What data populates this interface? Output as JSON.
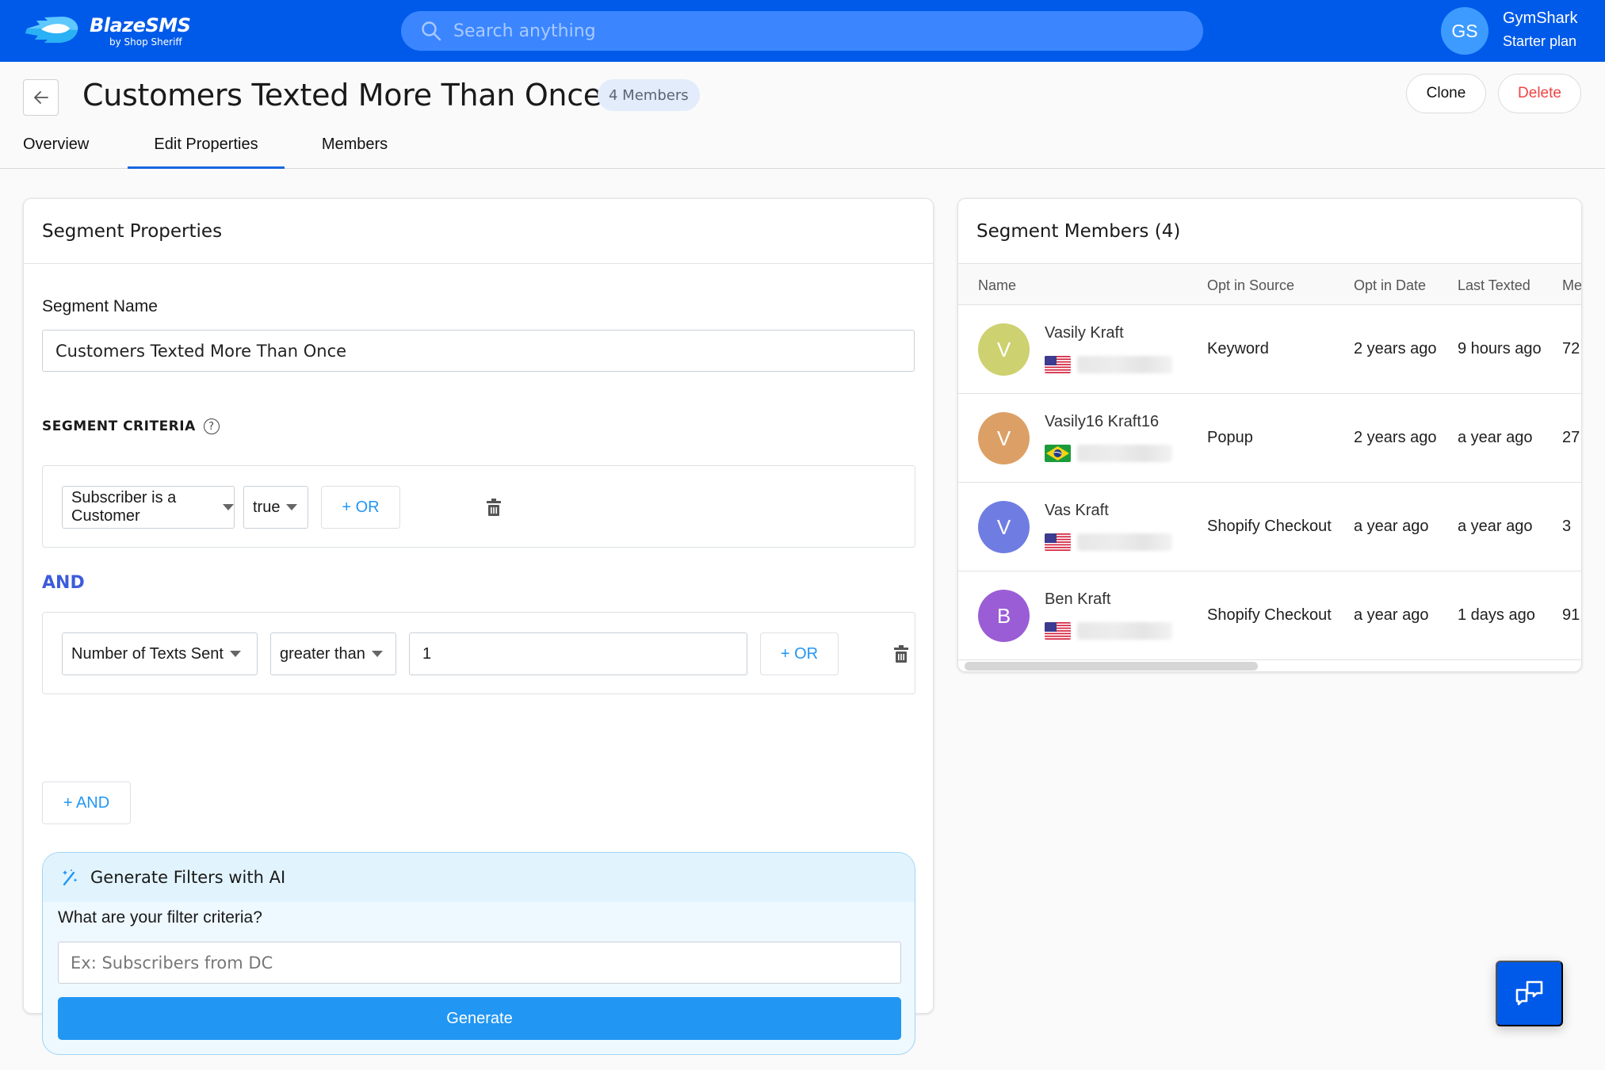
{
  "header": {
    "brand_name": "BlazeSMS",
    "brand_sub": "by Shop Sheriff",
    "search_placeholder": "Search anything",
    "user_initials": "GS",
    "user_name": "GymShark",
    "user_plan": "Starter plan"
  },
  "page": {
    "title": "Customers Texted More Than Once",
    "members_badge": "4 Members",
    "clone_label": "Clone",
    "delete_label": "Delete",
    "tabs": [
      {
        "label": "Overview",
        "active": false
      },
      {
        "label": "Edit Properties",
        "active": true
      },
      {
        "label": "Members",
        "active": false
      }
    ]
  },
  "properties": {
    "title": "Segment Properties",
    "name_label": "Segment Name",
    "name_value": "Customers Texted More Than Once",
    "criteria_title": "SEGMENT CRITERIA",
    "help_icon": "?",
    "rules": [
      {
        "field": "Subscriber is a Customer",
        "operator": "true",
        "value": null,
        "or_label": "+ OR"
      },
      {
        "field": "Number of Texts Sent",
        "operator": "greater than",
        "value": "1",
        "or_label": "+ OR"
      }
    ],
    "and_label": "AND",
    "add_and_label": "+ AND",
    "ai": {
      "title": "Generate Filters with AI",
      "question": "What are your filter criteria?",
      "placeholder": "Ex: Subscribers from DC",
      "button_label": "Generate"
    }
  },
  "members": {
    "title": "Segment Members",
    "count": "(4)",
    "columns": [
      "Name",
      "Opt in Source",
      "Opt in Date",
      "Last Texted",
      "Me"
    ],
    "rows": [
      {
        "initial": "V",
        "avatar_color": "#cdd16f",
        "name": "Vasily Kraft",
        "flag": "us",
        "source": "Keyword",
        "opt_in_date": "2 years ago",
        "last_texted": "9 hours ago",
        "messages": "72"
      },
      {
        "initial": "V",
        "avatar_color": "#dca066",
        "name": "Vasily16 Kraft16",
        "flag": "br",
        "source": "Popup",
        "opt_in_date": "2 years ago",
        "last_texted": "a year ago",
        "messages": "27"
      },
      {
        "initial": "V",
        "avatar_color": "#6f7de3",
        "name": "Vas Kraft",
        "flag": "us",
        "source": "Shopify Checkout",
        "opt_in_date": "a year ago",
        "last_texted": "a year ago",
        "messages": "3"
      },
      {
        "initial": "B",
        "avatar_color": "#9b5dd6",
        "name": "Ben Kraft",
        "flag": "us",
        "source": "Shopify Checkout",
        "opt_in_date": "a year ago",
        "last_texted": "1 days ago",
        "messages": "91"
      }
    ]
  },
  "colors": {
    "brand_blue": "#005ae9",
    "accent_blue": "#2196f3",
    "and_blue": "#3d5bdb",
    "delete_red": "#ef4444"
  },
  "icons": {
    "logo": "blazesms-logo-icon",
    "search": "search-icon",
    "back": "arrow-left-icon",
    "help": "question-circle-icon",
    "trash": "trash-icon",
    "magic": "magic-wand-icon",
    "chat": "chat-bubbles-icon"
  }
}
